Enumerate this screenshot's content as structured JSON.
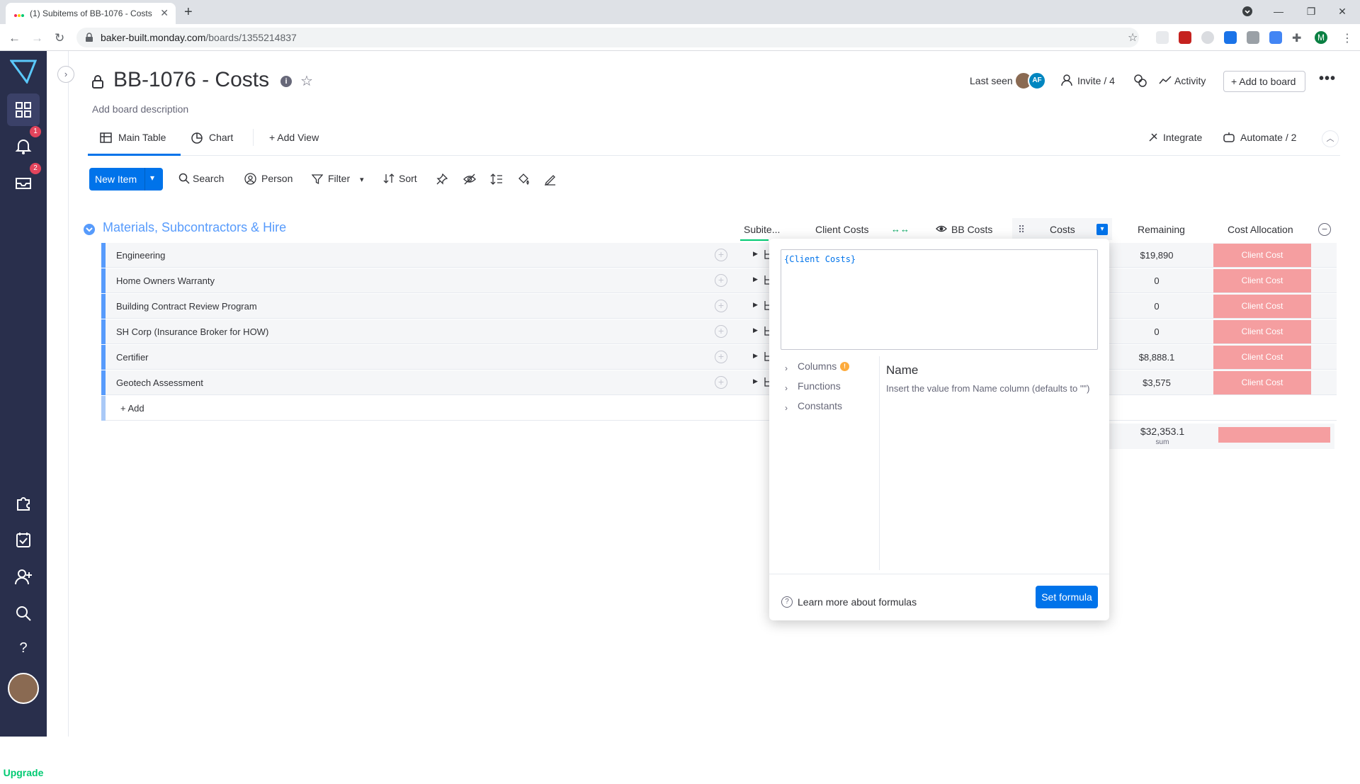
{
  "browser": {
    "tab_title": "(1) Subitems of BB-1076 - Costs",
    "url_host": "baker-built.monday.com",
    "url_path": "/boards/1355214837",
    "profile_initial": "M"
  },
  "rail": {
    "notif_badge": "1",
    "inbox_badge": "2",
    "upgrade": "Upgrade"
  },
  "board": {
    "title": "BB-1076 - Costs",
    "description": "Add board description",
    "last_seen": "Last seen",
    "avatar_initials": "AF",
    "invite": "Invite / 4",
    "activity": "Activity",
    "add_to_board": "+ Add to board"
  },
  "views": {
    "main_table": "Main Table",
    "chart": "Chart",
    "add_view": "+ Add View",
    "integrate": "Integrate",
    "automate": "Automate / 2"
  },
  "toolbar": {
    "new_item": "New Item",
    "search": "Search",
    "person": "Person",
    "filter": "Filter",
    "sort": "Sort"
  },
  "group": {
    "title": "Materials, Subcontractors & Hire",
    "columns": {
      "subitems": "Subite...",
      "client_costs": "Client Costs",
      "bb_costs": "BB Costs",
      "costs": "Costs",
      "remaining": "Remaining",
      "cost_allocation": "Cost Allocation"
    },
    "rows": [
      {
        "name": "Engineering",
        "remaining": "$19,890",
        "allocation": "Client Cost"
      },
      {
        "name": "Home Owners Warranty",
        "remaining": "0",
        "allocation": "Client Cost"
      },
      {
        "name": "Building Contract Review Program",
        "remaining": "0",
        "allocation": "Client Cost"
      },
      {
        "name": "SH Corp (Insurance Broker for HOW)",
        "remaining": "0",
        "allocation": "Client Cost"
      },
      {
        "name": "Certifier",
        "remaining": "$8,888.1",
        "allocation": "Client Cost"
      },
      {
        "name": "Geotech Assessment",
        "remaining": "$3,575",
        "allocation": "Client Cost"
      }
    ],
    "add_row": "+ Add",
    "sum_value": "$32,353.1",
    "sum_label": "sum"
  },
  "formula": {
    "expression": "{Client Costs}",
    "nav": [
      "Columns",
      "Functions",
      "Constants"
    ],
    "selected_name": "Name",
    "selected_desc": "Insert the value from Name column (defaults to \"\")",
    "learn_more": "Learn more about formulas",
    "set_formula": "Set formula"
  },
  "colors": {
    "accent": "#0073ea",
    "group": "#579bfc",
    "allocation": "#f59ea0",
    "rail": "#292f4c",
    "upgrade": "#00ca72"
  }
}
